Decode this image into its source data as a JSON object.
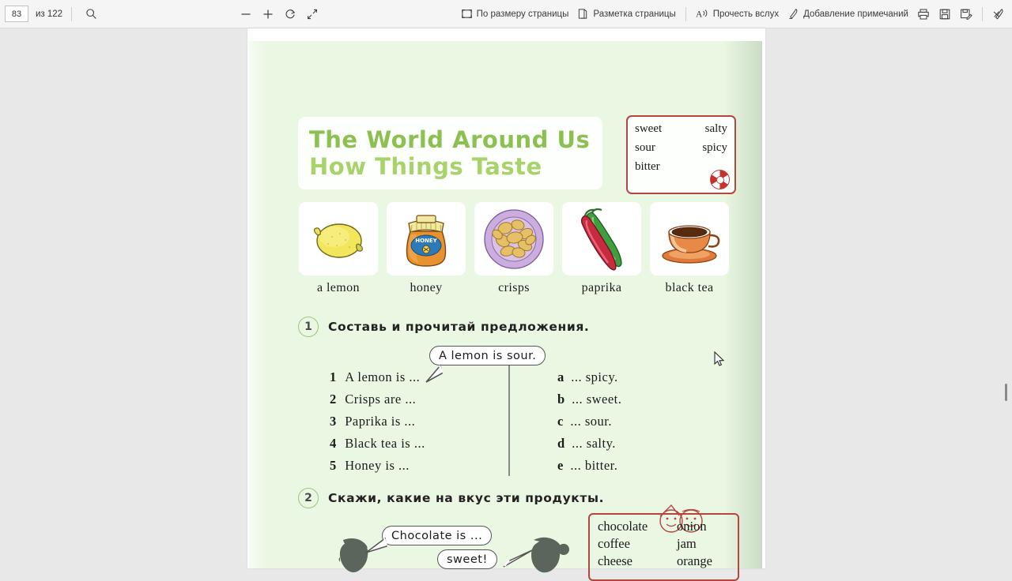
{
  "toolbar": {
    "page_value": "83",
    "page_total": "из 122",
    "search_icon": "search-icon",
    "zoom_out_icon": "minus-icon",
    "zoom_in_icon": "plus-icon",
    "rotate_icon": "rotate-icon",
    "collapse_icon": "collapse-arrows-icon",
    "fit_page_label": "По размеру страницы",
    "fit_page_icon": "fit-page-icon",
    "page_layout_label": "Разметка страницы",
    "page_layout_icon": "page-layout-icon",
    "read_aloud_label": "Прочесть вслух",
    "read_aloud_icon": "read-aloud-icon",
    "add_notes_label": "Добавление примечаний",
    "add_notes_icon": "pen-note-icon",
    "print_icon": "print-icon",
    "save_icon": "save-icon",
    "save_as_icon": "save-as-icon",
    "highlight_icon": "highlighter-pen-icon"
  },
  "document": {
    "title_line1": "The World Around Us",
    "title_line2": "How Things Taste",
    "taste_box": {
      "rows": [
        [
          "sweet",
          "salty"
        ],
        [
          "sour",
          "spicy"
        ],
        [
          "bitter",
          ""
        ]
      ],
      "cd_icon": "cd-audio-icon"
    },
    "cards": [
      {
        "label": "a lemon",
        "icon": "lemon-icon"
      },
      {
        "label": "honey",
        "icon": "honey-jar-icon"
      },
      {
        "label": "crisps",
        "icon": "crisps-plate-icon"
      },
      {
        "label": "paprika",
        "icon": "chili-peppers-icon"
      },
      {
        "label": "black tea",
        "icon": "tea-cup-icon"
      }
    ],
    "exercise1": {
      "number": "1",
      "instruction": "Составь и прочитай предложения.",
      "example_bubble": "A lemon is sour.",
      "left_items": [
        {
          "mark": "1",
          "text": "A lemon is ..."
        },
        {
          "mark": "2",
          "text": "Crisps are ..."
        },
        {
          "mark": "3",
          "text": "Paprika is ..."
        },
        {
          "mark": "4",
          "text": "Black tea is ..."
        },
        {
          "mark": "5",
          "text": "Honey is ..."
        }
      ],
      "right_items": [
        {
          "mark": "a",
          "text": "... spicy."
        },
        {
          "mark": "b",
          "text": "... sweet."
        },
        {
          "mark": "c",
          "text": "... sour."
        },
        {
          "mark": "d",
          "text": "... salty."
        },
        {
          "mark": "e",
          "text": "... bitter."
        }
      ]
    },
    "exercise2": {
      "number": "2",
      "instruction": "Скажи, какие на вкус эти продукты.",
      "smileys_icon": "two-smiley-faces-icon",
      "bubble_left": "Chocolate is ...",
      "bubble_right": "sweet!",
      "head_left_icon": "boy-head-silhouette-icon",
      "head_right_icon": "girl-head-silhouette-icon",
      "food_box": {
        "rows": [
          [
            "chocolate",
            "onion"
          ],
          [
            "coffee",
            "jam"
          ],
          [
            "cheese",
            "orange"
          ]
        ]
      }
    }
  },
  "colors": {
    "page_bg": "#eaf7e2",
    "title_green_dark": "#8cc152",
    "title_green_light": "#a8d26a",
    "box_red": "#b5453d",
    "toolbar_bg": "#f5f5f5"
  }
}
